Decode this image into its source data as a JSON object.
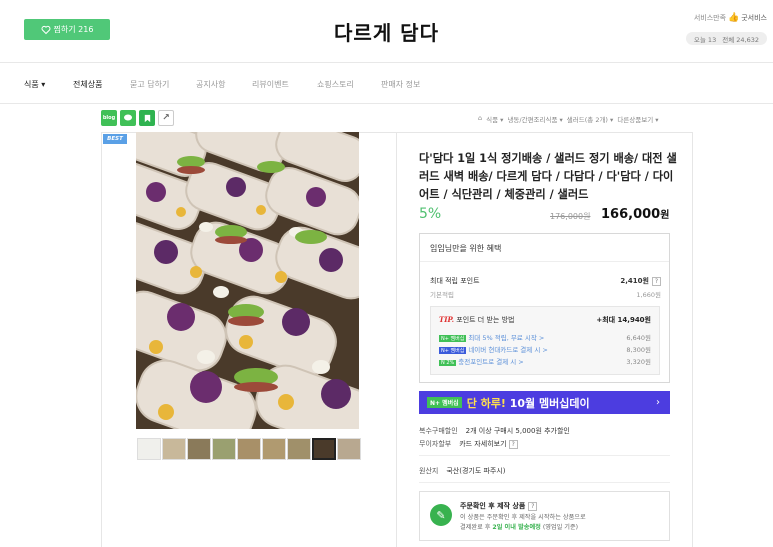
{
  "header": {
    "fav_label": "찜하기 216",
    "store_title": "다르게 담다",
    "service_label": "서비스만족",
    "service_value": "굿서비스",
    "visits_today": "오늘 13",
    "visits_total": "전체 24,632"
  },
  "nav": [
    "식품 ▾",
    "전체상품",
    "묻고 답하기",
    "공지사항",
    "리뷰이벤트",
    "쇼핑스토리",
    "판매자 정보"
  ],
  "toolbar": {
    "blog": "blog",
    "share": "↗"
  },
  "breadcrumb": [
    "⌂",
    "식품 ▾",
    "냉동/간편조리식품 ▾",
    "샐러드(총 2개) ▾",
    "다른상품보기 ▾"
  ],
  "badge": "BEST",
  "product": {
    "title": "다'담다 1일 1식 정기배송 / 샐러드 정기 배송/ 대전 샐러드 새벽 배송/ 다르게 담다 / 다담다 / 다'담다 / 다이어트 / 식단관리 / 체중관리 / 샐러드",
    "discount": "5%",
    "original_price": "176,000원",
    "price": "166,000",
    "price_unit": "원"
  },
  "benefit": {
    "heading": "임임님만을 위한 혜택",
    "max_points_label": "최대 적립 포인트",
    "max_points_value": "2,410원",
    "basic_label": "기본적립",
    "basic_value": "1,660원",
    "tip_label": "TIP.",
    "tip_text": "포인트 더 받는 방법",
    "tip_max": "+최대 14,940원",
    "tips": [
      {
        "badge": "N+ 멤버십",
        "text": "최대 5% 적립, 무료 시작 >",
        "amount": "6,640원"
      },
      {
        "badge": "N+ 멤버십",
        "text": "네이버 현대카드로 결제 시 >",
        "amount": "8,300원"
      },
      {
        "badge": "N 2%",
        "text": "충전포인트로 결제 시 >",
        "amount": "3,320원"
      }
    ]
  },
  "banner": {
    "tag": "N+ 멤버십",
    "text_a": "단 하루!",
    "text_b": " 10월 멤버십데이",
    "arrow": "›"
  },
  "info": {
    "multi_label": "복수구매할인",
    "multi_value": "2개 이상 구매시 5,000원 추가할인",
    "installment_label": "무이자할부",
    "installment_value": "카드 자세히보기",
    "origin_label": "원산지",
    "origin_value": "국산(경기도 파주시)"
  },
  "made": {
    "title": "주문확인 후 제작 상품",
    "desc_a": "이 상품은 주문확인 후 제작을 시작하는 상품으로",
    "desc_b_pre": "결제완료 후 ",
    "desc_b_green": "2일 이내 발송예정",
    "desc_b_post": " (영업일 기준)"
  },
  "colors": {
    "green": "#50c878",
    "banner": "#4c3de0",
    "discount": "#50c070"
  }
}
